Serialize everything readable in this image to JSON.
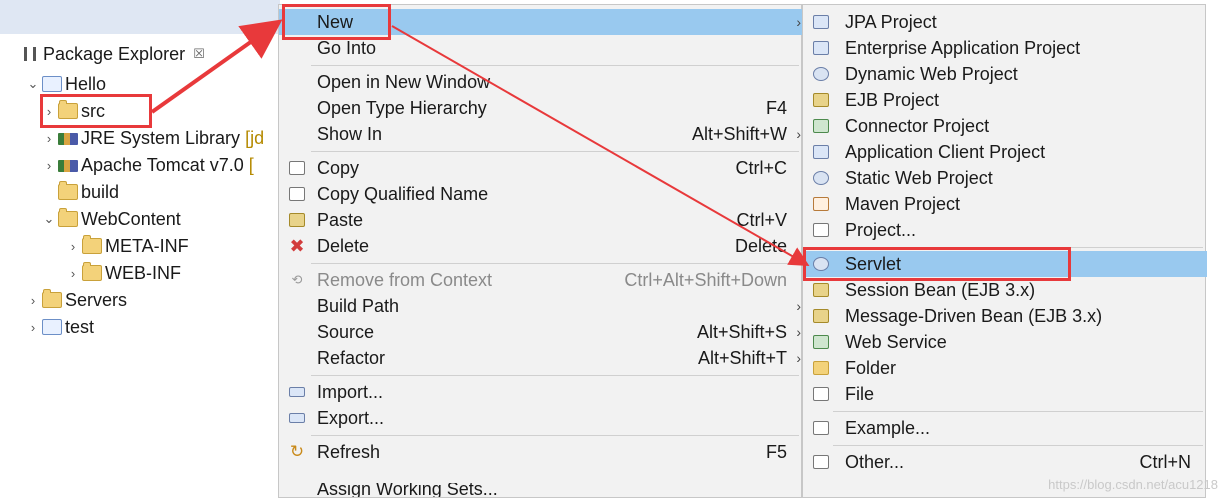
{
  "explorer": {
    "title": "Package Explorer",
    "close_glyph": "☒",
    "tree": [
      {
        "label": "Hello",
        "chev": "⌄",
        "icon": "project-icon",
        "kind": "proj"
      },
      {
        "label": "src",
        "chev": "›",
        "icon": "source-folder-icon",
        "kind": "folder"
      },
      {
        "label": "JRE System Library",
        "suffix": "[jd",
        "chev": "›",
        "icon": "library-icon",
        "kind": "lib"
      },
      {
        "label": "Apache Tomcat v7.0",
        "suffix": "[",
        "chev": "›",
        "icon": "library-icon",
        "kind": "lib"
      },
      {
        "label": "build",
        "chev": "",
        "icon": "folder-icon",
        "kind": "folder"
      },
      {
        "label": "WebContent",
        "chev": "⌄",
        "icon": "folder-icon",
        "kind": "folder"
      },
      {
        "label": "META-INF",
        "chev": "›",
        "icon": "folder-icon",
        "kind": "folder"
      },
      {
        "label": "WEB-INF",
        "chev": "›",
        "icon": "folder-icon",
        "kind": "folder"
      },
      {
        "label": "Servers",
        "chev": "›",
        "icon": "folder-icon",
        "kind": "folder"
      },
      {
        "label": "test",
        "chev": "›",
        "icon": "project-icon",
        "kind": "proj"
      }
    ]
  },
  "context_menu": {
    "items": [
      {
        "label": "New",
        "shortcut": "",
        "arrow": "›",
        "selected": true
      },
      {
        "label": "Go Into",
        "shortcut": ""
      },
      {
        "label": "Open in New Window",
        "shortcut": ""
      },
      {
        "label": "Open Type Hierarchy",
        "shortcut": "F4"
      },
      {
        "label": "Show In",
        "shortcut": "Alt+Shift+W",
        "arrow": "›"
      },
      {
        "label": "Copy",
        "shortcut": "Ctrl+C",
        "icon": "copy-icon"
      },
      {
        "label": "Copy Qualified Name",
        "shortcut": "",
        "icon": "copy-qualified-icon"
      },
      {
        "label": "Paste",
        "shortcut": "Ctrl+V",
        "icon": "paste-icon"
      },
      {
        "label": "Delete",
        "shortcut": "Delete",
        "icon": "delete-icon"
      },
      {
        "label": "Remove from Context",
        "shortcut": "Ctrl+Alt+Shift+Down",
        "icon": "remove-context-icon",
        "disabled": true
      },
      {
        "label": "Build Path",
        "shortcut": "",
        "arrow": "›"
      },
      {
        "label": "Source",
        "shortcut": "Alt+Shift+S",
        "arrow": "›"
      },
      {
        "label": "Refactor",
        "shortcut": "Alt+Shift+T",
        "arrow": "›"
      },
      {
        "label": "Import...",
        "shortcut": "",
        "icon": "import-icon"
      },
      {
        "label": "Export...",
        "shortcut": "",
        "icon": "export-icon"
      },
      {
        "label": "Refresh",
        "shortcut": "F5",
        "icon": "refresh-icon"
      },
      {
        "label": "Assign Working Sets...",
        "shortcut": ""
      }
    ]
  },
  "submenu": {
    "items": [
      {
        "label": "JPA Project",
        "icon": "jpa-project-icon"
      },
      {
        "label": "Enterprise Application Project",
        "icon": "ear-project-icon"
      },
      {
        "label": "Dynamic Web Project",
        "icon": "dynamic-web-project-icon"
      },
      {
        "label": "EJB Project",
        "icon": "ejb-project-icon"
      },
      {
        "label": "Connector Project",
        "icon": "connector-project-icon"
      },
      {
        "label": "Application Client Project",
        "icon": "app-client-project-icon"
      },
      {
        "label": "Static Web Project",
        "icon": "static-web-project-icon"
      },
      {
        "label": "Maven Project",
        "icon": "maven-project-icon"
      },
      {
        "label": "Project...",
        "icon": "project-icon"
      },
      {
        "label": "Servlet",
        "icon": "servlet-icon",
        "selected": true
      },
      {
        "label": "Session Bean (EJB 3.x)",
        "icon": "session-bean-icon"
      },
      {
        "label": "Message-Driven Bean (EJB 3.x)",
        "icon": "mdb-icon"
      },
      {
        "label": "Web Service",
        "icon": "web-service-icon"
      },
      {
        "label": "Folder",
        "icon": "folder-icon"
      },
      {
        "label": "File",
        "icon": "file-icon"
      },
      {
        "label": "Example...",
        "icon": "example-icon"
      },
      {
        "label": "Other...",
        "shortcut": "Ctrl+N",
        "icon": "other-icon"
      }
    ]
  },
  "watermark": "https://blog.csdn.net/acu1218",
  "colors": {
    "highlight": "#99c9ef",
    "annotation": "#e8393b",
    "menu_bg": "#f2f2f2"
  }
}
